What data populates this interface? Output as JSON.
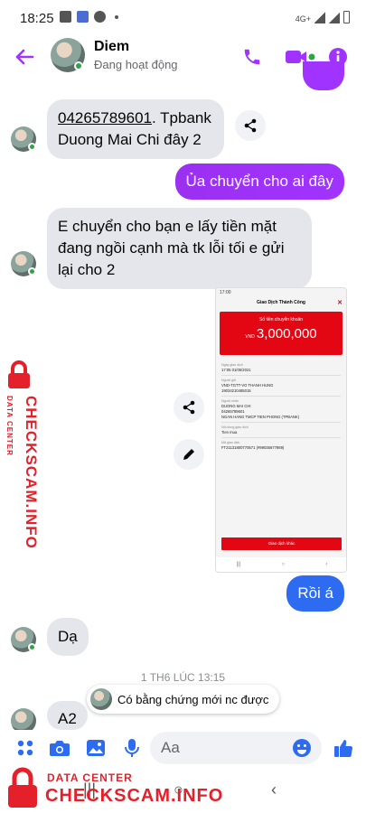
{
  "status_bar": {
    "time": "18:25",
    "network": "4G+"
  },
  "header": {
    "name": "Diem",
    "status": "Đang hoạt động"
  },
  "messages": {
    "m1_account": "04265789601",
    "m1_rest": ". Tpbank Duong Mai Chi đây 2",
    "m2": "Ủa chuyển cho ai đây",
    "m3": "E chuyển cho bạn e lấy tiền mặt đang ngồi cạnh mà tk lỗi tối e gửi lại cho 2",
    "m4": "Rồi á",
    "m5": "Dạ",
    "m6": "A2"
  },
  "screenshot": {
    "status_time": "17:00",
    "title": "Giao Dịch Thành Công",
    "amount_label": "Số tiền chuyển khoản",
    "currency": "VND",
    "amount": "3,000,000",
    "date_label": "Ngày giao dịch",
    "date": "17:05 01/05/2021",
    "sender_label": "Người gửi",
    "sender": "VND-TGTT-VO THANH HUNG",
    "sender_acct": "19034210485015",
    "receiver_label": "Người nhận",
    "receiver": "DUONG MAI CHI",
    "receiver_acct": "04265789601",
    "bank": "NGAN HANG TMCP TIEN PHONG (TPBANK)",
    "content_label": "Nội dung giao dịch",
    "content": "Tien mua",
    "code_label": "Mã giao dịch",
    "code": "FT21131800770571 (#99035677989)",
    "button": "Giao dịch khác"
  },
  "system": {
    "timestamp": "1 TH6 LÚC 13:15",
    "reply_chip": "Có bằng chứng mới nc được"
  },
  "composer": {
    "placeholder": "Aa"
  },
  "watermark": {
    "small": "DATA CENTER",
    "big": "CHECKSCAM.INFO"
  },
  "colors": {
    "accent": "#a033ff",
    "gradient_purple": "#9b30f0",
    "blue_bubble": "#2d6cf0",
    "online": "#31a24c",
    "watermark": "#e4202a"
  }
}
